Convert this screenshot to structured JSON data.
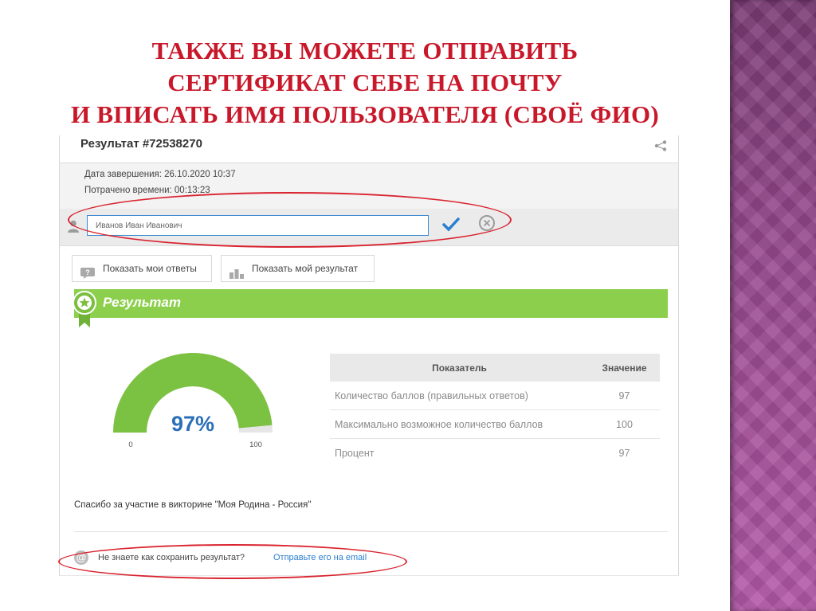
{
  "slide": {
    "title_lines": [
      "ТАКЖЕ ВЫ МОЖЕТЕ ОТПРАВИТЬ",
      "СЕРТИФИКАТ СЕБЕ НА ПОЧТУ",
      "И ВПИСАТЬ ИМЯ ПОЛЬЗОВАТЕЛЯ (СВОЁ ФИО)"
    ],
    "side_color": "#9a4b91",
    "title_color": "#c8182a"
  },
  "result": {
    "header": "Результат #72538270",
    "completion_date": "Дата завершения: 26.10.2020 10:37",
    "time_spent": "Потрачено времени: 00:13:23",
    "name_value": "Иванов Иван Иванович",
    "buttons": {
      "show_answers": "Показать мои ответы",
      "show_result": "Показать мой результат"
    },
    "section_title": "Результат",
    "gauge": {
      "value_text": "97%",
      "percent": 97,
      "min_label": "0",
      "max_label": "100"
    },
    "table": {
      "headers": [
        "Показатель",
        "Значение"
      ],
      "rows": [
        {
          "label": "Количество баллов (правильных ответов)",
          "value": "97"
        },
        {
          "label": "Максимально возможное количество баллов",
          "value": "100"
        },
        {
          "label": "Процент",
          "value": "97"
        }
      ]
    },
    "thanks": "Спасибо за участие в викторине \"Моя Родина - Россия\"",
    "save_question": "Не знаете как сохранить результат?",
    "save_link": "Отправьте его на email",
    "colors": {
      "accent_green": "#8ccf4d",
      "link_blue": "#2a7fcf",
      "highlight_red": "#d92430"
    }
  }
}
